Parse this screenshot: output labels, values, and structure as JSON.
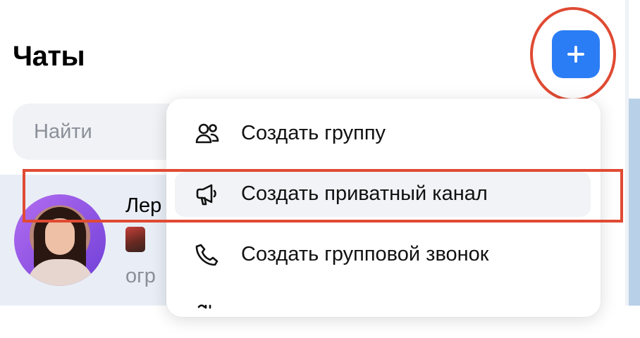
{
  "header": {
    "title": "Чаты",
    "add_icon": "plus-icon"
  },
  "search": {
    "placeholder": "Найти"
  },
  "chat_list": {
    "items": [
      {
        "name": "Лер",
        "preview": "огр",
        "avatar": "avatar",
        "thumbnail": "message-thumbnail"
      }
    ]
  },
  "menu": {
    "items": [
      {
        "label": "Создать группу",
        "icon": "group-icon"
      },
      {
        "label": "Создать приватный канал",
        "icon": "megaphone-icon"
      },
      {
        "label": "Создать групповой звонок",
        "icon": "phone-icon"
      }
    ]
  },
  "colors": {
    "accent": "#2b7df6",
    "highlight": "#e04a33",
    "search_bg": "#f1f2f5",
    "chat_row_bg": "#e9eef6",
    "muted_text": "#8a8f99"
  }
}
